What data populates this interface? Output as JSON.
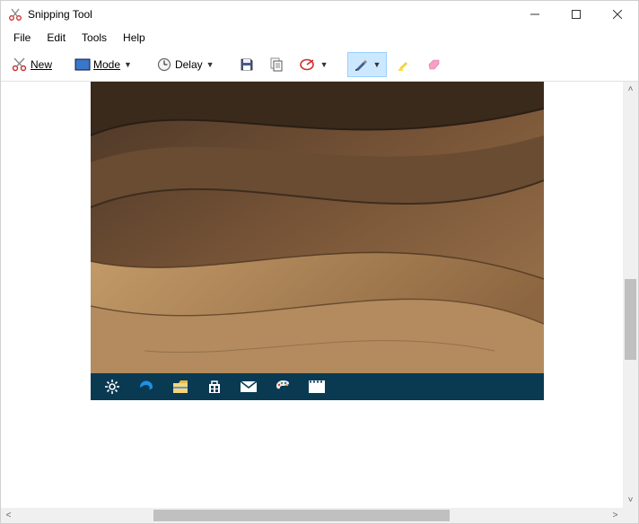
{
  "window": {
    "title": "Snipping Tool",
    "icon": "scissors-icon"
  },
  "menubar": {
    "items": [
      "File",
      "Edit",
      "Tools",
      "Help"
    ]
  },
  "toolbar": {
    "new": {
      "label": "New",
      "icon": "scissors-icon"
    },
    "mode": {
      "label": "Mode",
      "icon": "rectangle-mode-icon"
    },
    "delay": {
      "label": "Delay",
      "icon": "clock-icon"
    },
    "save": {
      "icon": "save-icon"
    },
    "copy": {
      "icon": "copy-icon"
    },
    "send": {
      "icon": "send-mail-icon"
    },
    "pen": {
      "icon": "pen-icon",
      "selected": true
    },
    "highlighter": {
      "icon": "highlighter-icon"
    },
    "eraser": {
      "icon": "eraser-icon"
    }
  },
  "content": {
    "snip": {
      "description": "Screenshot capture showing a desert sand dunes desktop wallpaper and a portion of the Windows taskbar",
      "taskbar_icons": [
        "settings-gear-icon",
        "edge-browser-icon",
        "file-explorer-icon",
        "microsoft-store-icon",
        "mail-app-icon",
        "paint-app-icon",
        "movies-tv-icon"
      ]
    }
  }
}
